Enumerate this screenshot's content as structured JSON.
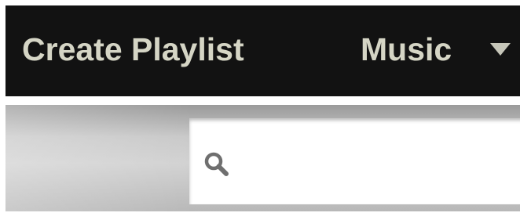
{
  "header": {
    "create_playlist_label": "Create Playlist",
    "music_menu_label": "Music"
  },
  "search": {
    "value": "",
    "placeholder": ""
  },
  "colors": {
    "topbar_bg": "#121212",
    "nav_text": "#d5d5c5",
    "search_band": "#c9c9c9"
  },
  "icons": {
    "search": "magnifier-icon",
    "menu_caret": "triangle-down-icon"
  }
}
